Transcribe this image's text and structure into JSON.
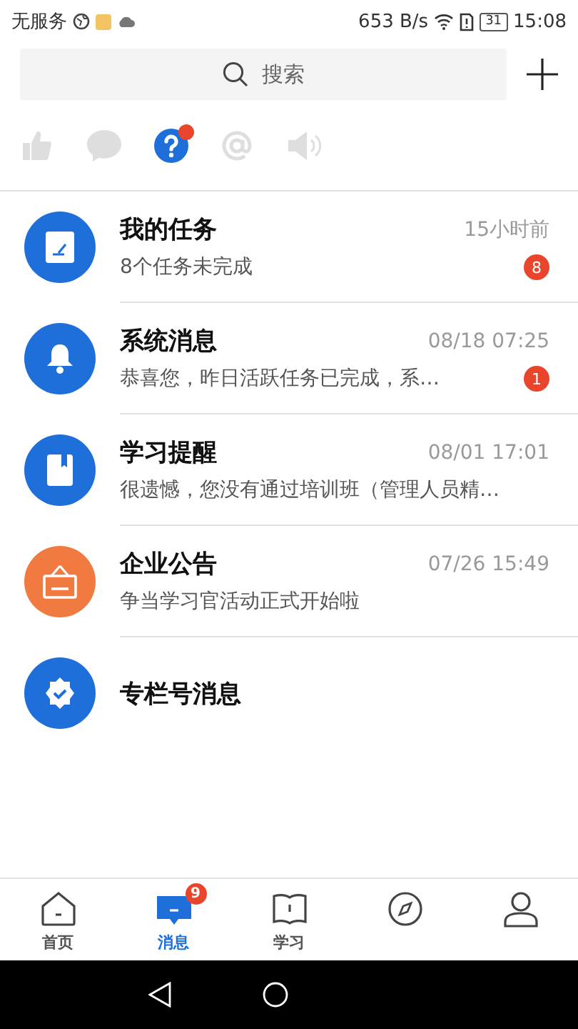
{
  "status_bar": {
    "carrier": "无服务",
    "speed": "653 B/s",
    "battery": "31",
    "time": "15:08"
  },
  "search": {
    "placeholder": "搜索"
  },
  "categories": [
    {
      "kind": "like",
      "selected": false,
      "dot": false
    },
    {
      "kind": "comment",
      "selected": false,
      "dot": false
    },
    {
      "kind": "question",
      "selected": true,
      "dot": true
    },
    {
      "kind": "mention",
      "selected": false,
      "dot": false
    },
    {
      "kind": "announce",
      "selected": false,
      "dot": false
    }
  ],
  "messages": [
    {
      "kind": "task",
      "color": "#1e6fd9",
      "title": "我的任务",
      "time": "15小时前",
      "preview": "8个任务未完成",
      "badge": "8"
    },
    {
      "kind": "bell",
      "color": "#1e6fd9",
      "title": "系统消息",
      "time": "08/18 07:25",
      "preview": "恭喜您，昨日活跃任务已完成，系…",
      "badge": "1"
    },
    {
      "kind": "book",
      "color": "#1e6fd9",
      "title": "学习提醒",
      "time": "08/01 17:01",
      "preview": "很遗憾，您没有通过培训班（管理人员精…"
    },
    {
      "kind": "board",
      "color": "#f07a3f",
      "title": "企业公告",
      "time": "07/26 15:49",
      "preview": "争当学习官活动正式开始啦"
    },
    {
      "kind": "badge",
      "color": "#1e6fd9",
      "title": "专栏号消息"
    }
  ],
  "tabs": [
    {
      "kind": "home",
      "label": "首页",
      "selected": false
    },
    {
      "kind": "message",
      "label": "消息",
      "selected": true,
      "badge": "9"
    },
    {
      "kind": "study",
      "label": "学习",
      "selected": false
    },
    {
      "kind": "discover",
      "selected": false
    },
    {
      "kind": "profile",
      "selected": false
    }
  ]
}
